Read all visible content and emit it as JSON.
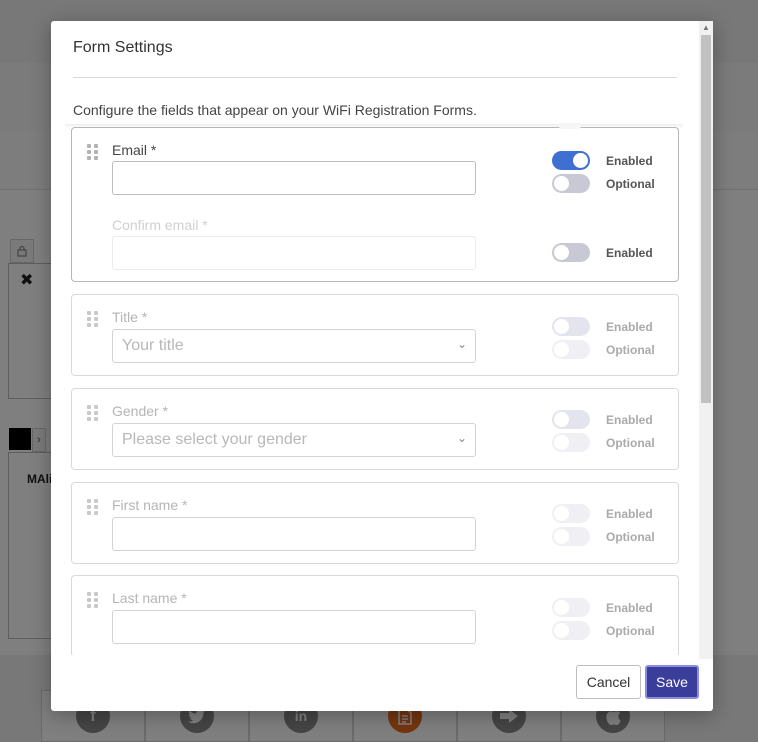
{
  "background": {
    "badge_text": "MAli",
    "social_icons": [
      "facebook-icon",
      "twitter-icon",
      "linkedin-icon",
      "document-icon",
      "arrow-right-icon",
      "apple-icon"
    ],
    "social_glyphs": [
      "f",
      "t",
      "in",
      "▤",
      "➡",
      ""
    ],
    "active_social": "document-icon",
    "active_color": "#e86a1c"
  },
  "modal": {
    "title": "Form Settings",
    "description": "Configure the fields that appear on your WiFi Registration Forms.",
    "fields": [
      {
        "label": "Email *",
        "type": "text",
        "value": "",
        "enabled_label": "Enabled",
        "enabled": true,
        "optional_label": "Optional",
        "optional": false,
        "confirm": {
          "label": "Confirm email *",
          "enabled_label": "Enabled",
          "enabled": false
        }
      },
      {
        "label": "Title *",
        "type": "select",
        "placeholder": "Your title",
        "enabled_label": "Enabled",
        "enabled": false,
        "optional_label": "Optional",
        "optional": false
      },
      {
        "label": "Gender *",
        "type": "select",
        "placeholder": "Please select your gender",
        "enabled_label": "Enabled",
        "enabled": false,
        "optional_label": "Optional",
        "optional": false
      },
      {
        "label": "First name *",
        "type": "text",
        "value": "",
        "enabled_label": "Enabled",
        "enabled": false,
        "optional_label": "Optional",
        "optional": false
      },
      {
        "label": "Last name *",
        "type": "text",
        "value": "",
        "enabled_label": "Enabled",
        "enabled": false,
        "optional_label": "Optional",
        "optional": false
      }
    ],
    "cancel_label": "Cancel",
    "save_label": "Save"
  },
  "colors": {
    "toggle_on": "#3f6fd1",
    "save_button": "#3b3d9a"
  }
}
